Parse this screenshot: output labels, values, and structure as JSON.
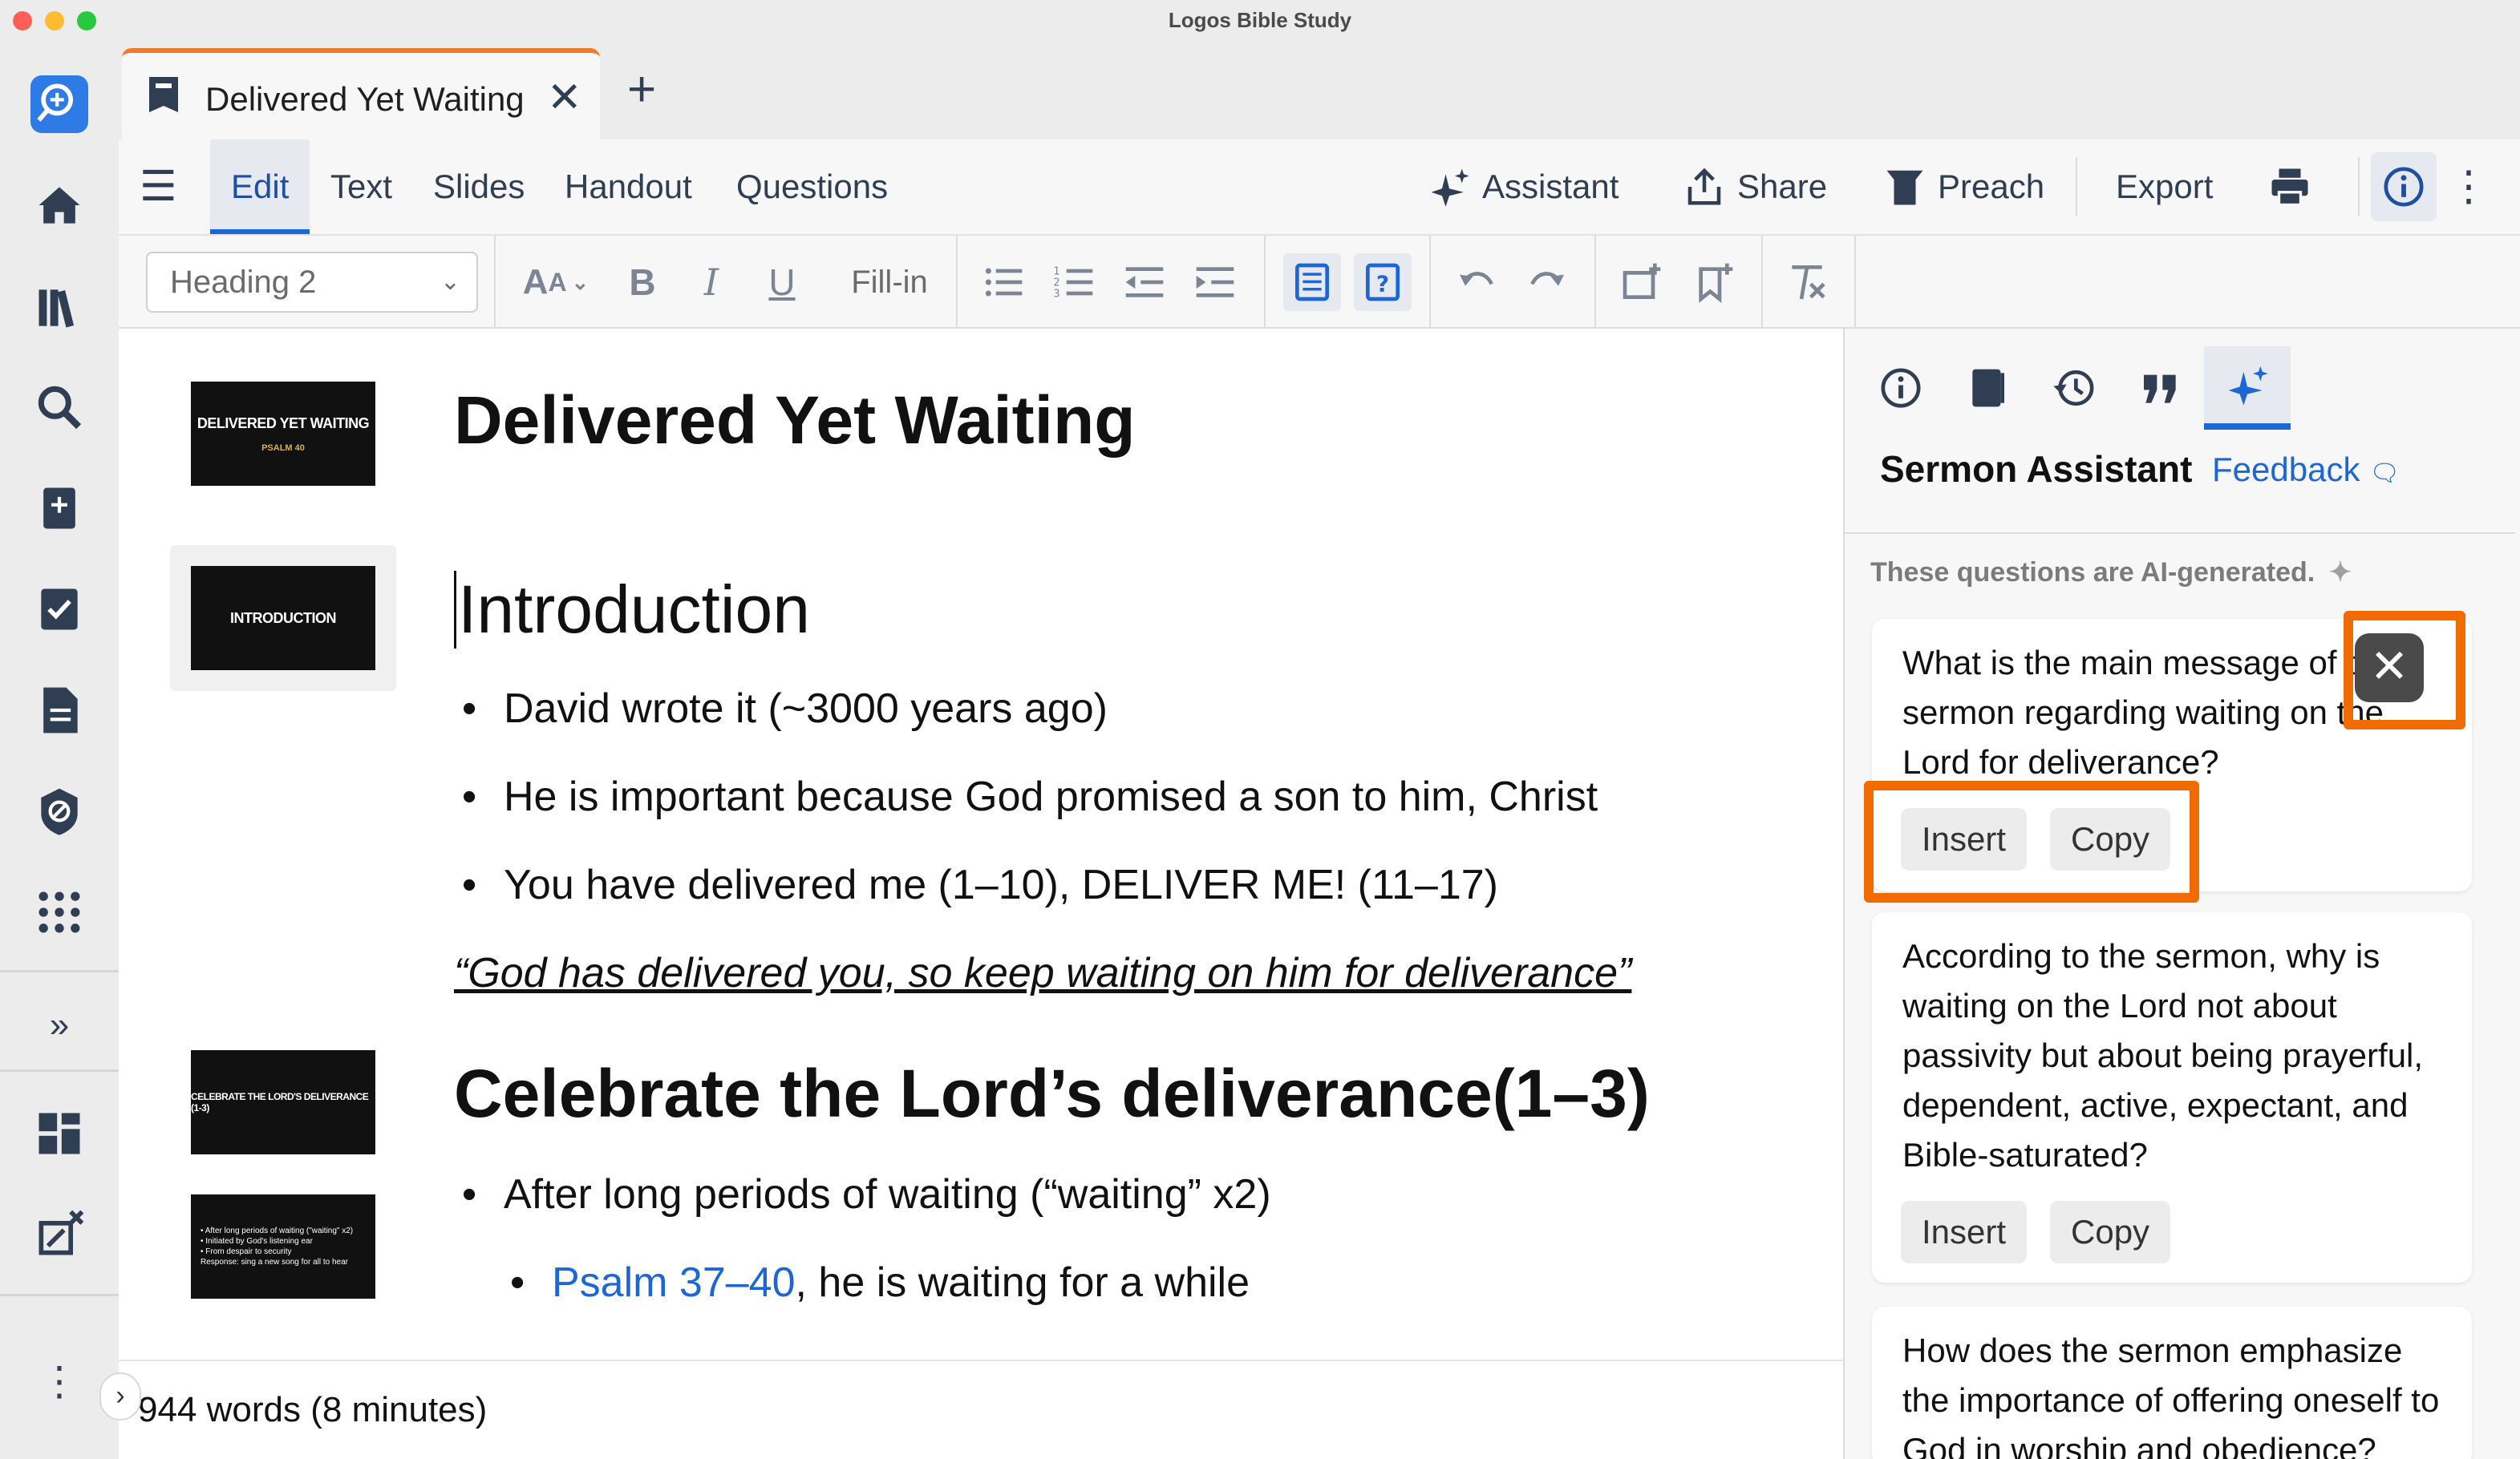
{
  "window": {
    "title": "Logos Bible Study"
  },
  "tab": {
    "title": "Delivered Yet Waiting"
  },
  "menu": {
    "items": [
      "Edit",
      "Text",
      "Slides",
      "Handout",
      "Questions"
    ],
    "assistant": "Assistant",
    "share": "Share",
    "preach": "Preach",
    "export": "Export"
  },
  "toolbar": {
    "style_value": "Heading 2",
    "fill_in": "Fill-in"
  },
  "slides": {
    "s1_title": "DELIVERED YET WAITING",
    "s1_sub": "PSALM 40",
    "s2_title": "INTRODUCTION",
    "s3_title": "CELEBRATE THE LORD'S DELIVERANCE (1-3)",
    "s4_lines": [
      "• After long periods of waiting (\"waiting\" x2)",
      "• Initiated by God's listening ear",
      "• From despair to security",
      "Response: sing a new song for all to hear"
    ]
  },
  "document": {
    "title": "Delivered Yet Waiting",
    "intro_heading": "Introduction",
    "intro_bullets": [
      "David wrote it (~3000 years ago)",
      "He is important because God promised a son to him, Christ",
      "You have delivered me (1–10), DELIVER ME! (11–17)"
    ],
    "quote": "“God has delivered you, so keep waiting on him for deliverance”",
    "section_heading": "Celebrate the Lord’s deliverance(1–3)",
    "section_bullet": "After long periods of waiting (“waiting” x2)",
    "sub_bullet_link": "Psalm 37–40",
    "sub_bullet_rest": ", he is waiting for a while"
  },
  "status": {
    "word_count": "944 words (8 minutes)"
  },
  "panel": {
    "title": "Sermon Assistant",
    "feedback": "Feedback",
    "ai_note": "These questions are AI-generated.",
    "questions": [
      {
        "text": "What is the main message of the sermon regarding waiting on the Lord for deliverance?",
        "insert": "Insert",
        "copy": "Copy"
      },
      {
        "text": "According to the sermon, why is waiting on the Lord not about passivity but about being prayerful, dependent, active, expectant, and Bible-saturated?",
        "insert": "Insert",
        "copy": "Copy"
      },
      {
        "text": "How does the sermon emphasize the importance of offering oneself to God in worship and obedience?"
      }
    ]
  },
  "colors": {
    "accent": "#1d66d6",
    "highlight": "#f26b00",
    "tab_accent": "#f07a2c"
  }
}
